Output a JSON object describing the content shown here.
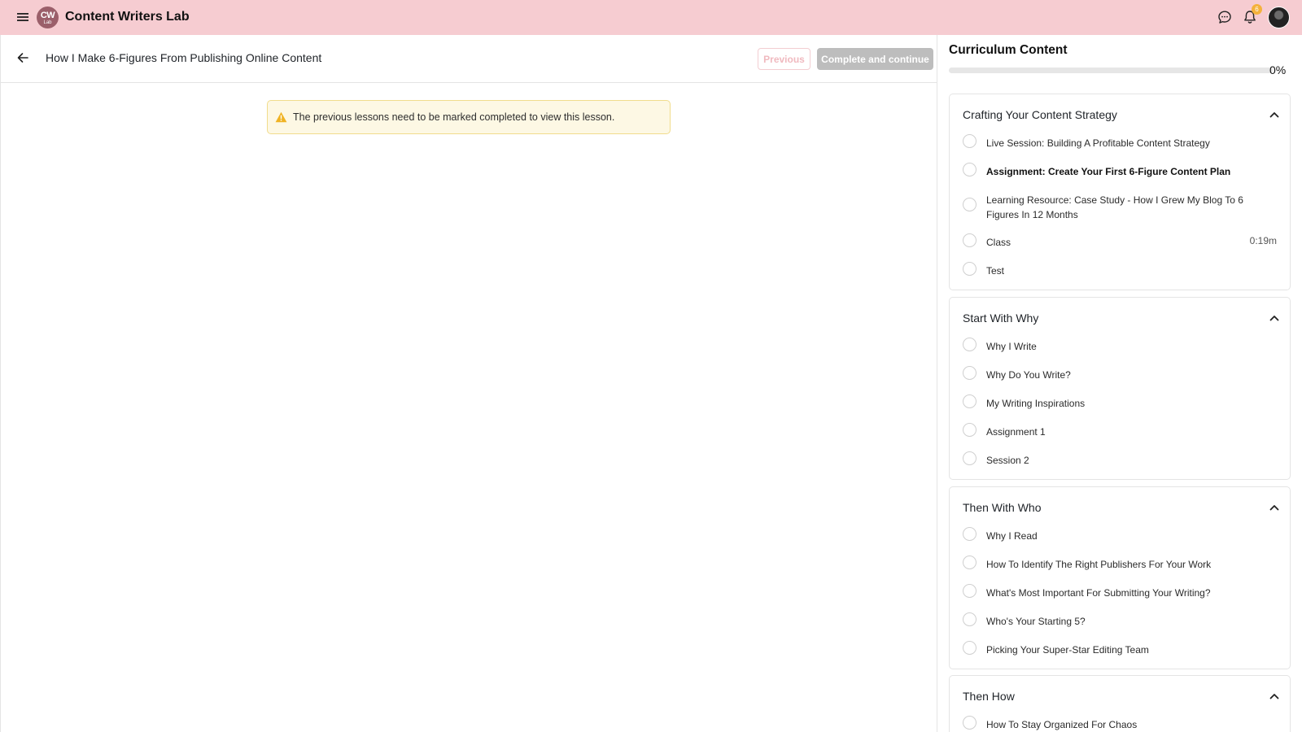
{
  "topbar": {
    "logo": {
      "line1": "CW",
      "line2": "Lab"
    },
    "app_name": "Content Writers Lab",
    "notification_count": "6",
    "icons": [
      "menu-icon",
      "chat-icon",
      "bell-icon",
      "avatar"
    ]
  },
  "lesson": {
    "title": "How I Make 6-Figures From Publishing Online Content",
    "previous_label": "Previous",
    "complete_label": "Complete and continue",
    "alert_text": "The previous lessons need to be marked completed to view this lesson."
  },
  "curriculum": {
    "title": "Curriculum Content",
    "progress_percent": 0,
    "progress_label": "0%",
    "sections": [
      {
        "title": "Crafting Your Content Strategy",
        "items": [
          {
            "label": "Live Session: Building A Profitable Content Strategy",
            "duration": ""
          },
          {
            "label": "Assignment: Create Your First 6-Figure Content Plan",
            "duration": "",
            "active": true
          },
          {
            "label": "Learning Resource: Case Study - How I Grew My Blog To 6 Figures In 12 Months",
            "duration": ""
          },
          {
            "label": "Class",
            "duration": "0:19m"
          },
          {
            "label": "Test",
            "duration": ""
          }
        ]
      },
      {
        "title": "Start With Why",
        "items": [
          {
            "label": "Why I Write"
          },
          {
            "label": "Why Do You Write?"
          },
          {
            "label": "My Writing Inspirations"
          },
          {
            "label": "Assignment 1"
          },
          {
            "label": "Session 2"
          }
        ]
      },
      {
        "title": "Then With Who",
        "items": [
          {
            "label": "Why I Read"
          },
          {
            "label": "How To Identify The Right Publishers For Your Work"
          },
          {
            "label": "What's Most Important For Submitting Your Writing?"
          },
          {
            "label": "Who's Your Starting 5?"
          },
          {
            "label": "Picking Your Super-Star Editing Team"
          }
        ]
      },
      {
        "title": "Then How",
        "items": [
          {
            "label": "How To Stay Organized For Chaos"
          }
        ]
      }
    ]
  },
  "colors": {
    "topbar_bg": "#f6ccd1",
    "brand": "#9b5f6a",
    "badge": "#f4b23c",
    "alert_bg": "#fdf8e4",
    "alert_border": "#f1dc8c",
    "button_disabled": "#bdbdbd"
  }
}
